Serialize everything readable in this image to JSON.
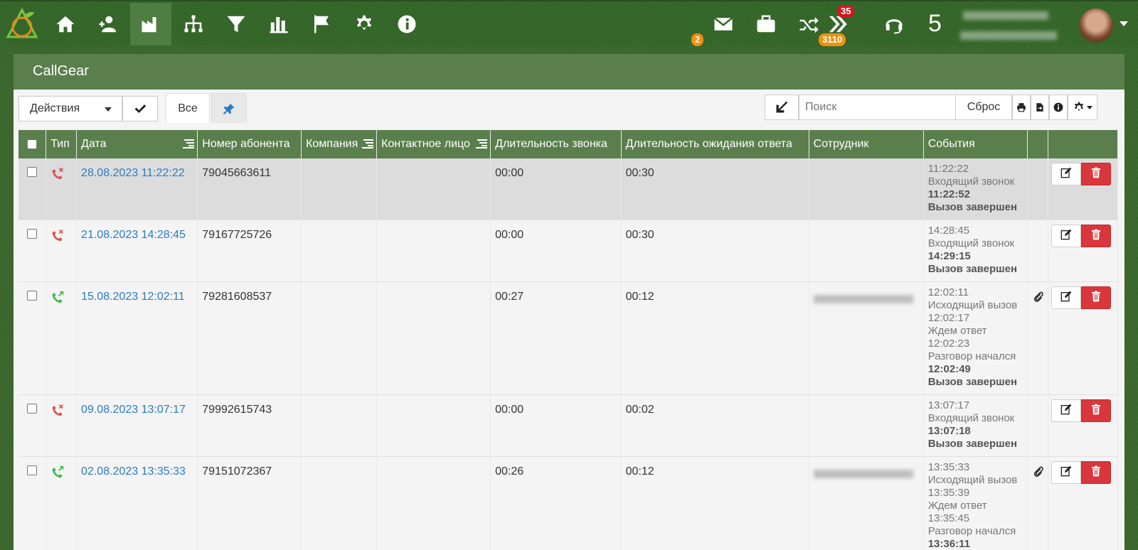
{
  "nav": {
    "badges": {
      "mail": "2",
      "arrows": "35",
      "arrows_sub": "3110"
    },
    "counter": "5"
  },
  "panel": {
    "title": "CallGear"
  },
  "toolbar": {
    "actions_label": "Действия",
    "tab_all": "Все",
    "search_placeholder": "Поиск",
    "reset_label": "Сброс"
  },
  "table": {
    "headers": [
      "Тип",
      "Дата",
      "Номер абонента",
      "Компания",
      "Контактное лицо",
      "Длительность звонка",
      "Длительность ожидания ответа",
      "Сотрудник",
      "События"
    ],
    "rows": [
      {
        "type": "missed",
        "date": "28.08.2023 11:22:22",
        "number": "79045663611",
        "duration": "00:00",
        "wait": "00:30",
        "events": [
          [
            "11:22:22",
            false
          ],
          [
            "Входящий звонок",
            false
          ],
          [
            "11:22:52",
            true
          ],
          [
            "Вызов завершен",
            true
          ]
        ],
        "attach": false
      },
      {
        "type": "missed",
        "date": "21.08.2023 14:28:45",
        "number": "79167725726",
        "duration": "00:00",
        "wait": "00:30",
        "events": [
          [
            "14:28:45",
            false
          ],
          [
            "Входящий звонок",
            false
          ],
          [
            "14:29:15",
            true
          ],
          [
            "Вызов завершен",
            true
          ]
        ],
        "attach": false
      },
      {
        "type": "outgoing",
        "date": "15.08.2023 12:02:11",
        "number": "79281608537",
        "duration": "00:27",
        "wait": "00:12",
        "events": [
          [
            "12:02:11",
            false
          ],
          [
            "Исходящий вызов",
            false
          ],
          [
            "12:02:17",
            false
          ],
          [
            "Ждем ответ",
            false
          ],
          [
            "12:02:23",
            false
          ],
          [
            "Разговор начался",
            false
          ],
          [
            "12:02:49",
            true
          ],
          [
            "Вызов завершен",
            true
          ]
        ],
        "attach": true
      },
      {
        "type": "missed",
        "date": "09.08.2023 13:07:17",
        "number": "79992615743",
        "duration": "00:00",
        "wait": "00:02",
        "events": [
          [
            "13:07:17",
            false
          ],
          [
            "Входящий звонок",
            false
          ],
          [
            "13:07:18",
            true
          ],
          [
            "Вызов завершен",
            true
          ]
        ],
        "attach": false
      },
      {
        "type": "outgoing",
        "date": "02.08.2023 13:35:33",
        "number": "79151072367",
        "duration": "00:26",
        "wait": "00:12",
        "events": [
          [
            "13:35:33",
            false
          ],
          [
            "Исходящий вызов",
            false
          ],
          [
            "13:35:39",
            false
          ],
          [
            "Ждем ответ",
            false
          ],
          [
            "13:35:45",
            false
          ],
          [
            "Разговор начался",
            false
          ],
          [
            "13:36:11",
            true
          ]
        ],
        "attach": true
      }
    ]
  },
  "colors": {
    "nav_bg": "#36692a",
    "panel_head": "#5a7f4d",
    "link": "#2a7bc4",
    "danger": "#d9373b",
    "missed": "#e05050",
    "outgoing": "#3cb94a"
  }
}
